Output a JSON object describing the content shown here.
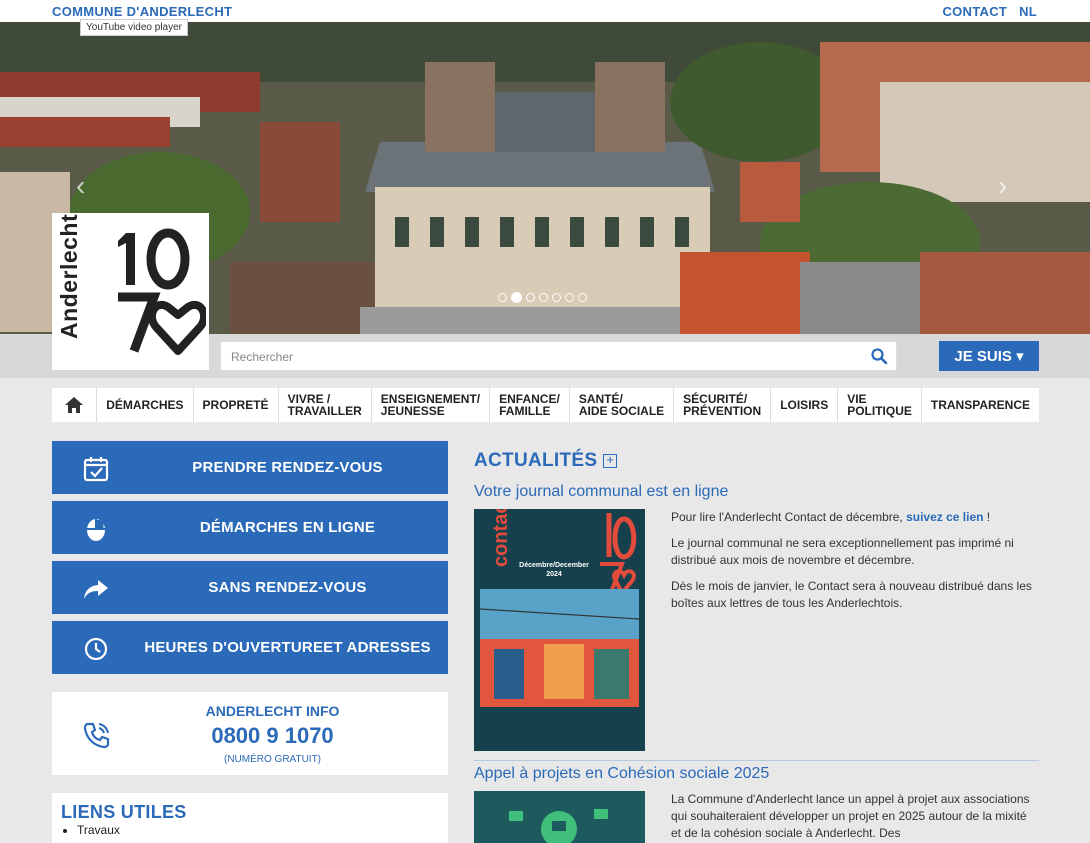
{
  "header": {
    "site_name": "COMMUNE D'ANDERLECHT",
    "contact": "CONTACT",
    "lang": "NL",
    "video_tooltip": "YouTube video player"
  },
  "hero": {
    "slides": 7,
    "active_slide": 2,
    "prev_icon": "chevron-left-icon",
    "next_icon": "chevron-right-icon"
  },
  "logo": {
    "word": "Anderlecht",
    "numerals": "1070"
  },
  "search": {
    "placeholder": "Rechercher",
    "icon": "search-icon"
  },
  "jesuis": {
    "label": "JE SUIS ▾"
  },
  "nav": {
    "home_icon": "home-icon",
    "items": [
      {
        "line1": "DÉMARCHES",
        "line2": ""
      },
      {
        "line1": "PROPRETÉ",
        "line2": ""
      },
      {
        "line1": "VIVRE /",
        "line2": "TRAVAILLER"
      },
      {
        "line1": "ENSEIGNEMENT/",
        "line2": "JEUNESSE"
      },
      {
        "line1": "ENFANCE/",
        "line2": "FAMILLE"
      },
      {
        "line1": "SANTÉ/",
        "line2": "AIDE SOCIALE"
      },
      {
        "line1": "SÉCURITÉ/",
        "line2": "PRÉVENTION"
      },
      {
        "line1": "LOISIRS",
        "line2": ""
      },
      {
        "line1": "VIE",
        "line2": "POLITIQUE"
      },
      {
        "line1": "TRANSPARENCE",
        "line2": ""
      }
    ]
  },
  "quick": [
    {
      "line1": "PRENDRE RENDEZ-VOUS",
      "line2": "",
      "icon": "calendar-check-icon"
    },
    {
      "line1": "DÉMARCHES EN LIGNE",
      "line2": "",
      "icon": "mouse-icon"
    },
    {
      "line1": "SANS RENDEZ-VOUS",
      "line2": "",
      "icon": "share-arrow-icon"
    },
    {
      "line1": "HEURES D'OUVERTURE",
      "line2": "ET ADRESSES",
      "icon": "clock-icon"
    }
  ],
  "info": {
    "title": "ANDERLECHT INFO",
    "phone": "0800 9 1070",
    "note": "(NUMÉRO GRATUIT)",
    "icon": "phone-ringing-icon"
  },
  "liens": {
    "title": "LIENS UTILES",
    "items": [
      "Travaux"
    ]
  },
  "actualites": {
    "title": "ACTUALITÉS",
    "articles": [
      {
        "title": "Votre journal communal est en ligne",
        "p1_before": "Pour lire l'Anderlecht Contact de décembre, ",
        "p1_link": "suivez ce lien",
        "p1_after": " !",
        "p2": "Le journal communal ne sera exceptionnellement pas imprimé ni distribué aux mois de novembre et décembre.",
        "p3": "Dès le mois de janvier, le Contact sera à nouveau distribué dans les boîtes aux lettres de tous les Anderlechtois.",
        "cover_title": "contact",
        "cover_date": "Décembre/December 2024"
      },
      {
        "title": "Appel à projets en Cohésion sociale 2025",
        "p1": "La Commune d'Anderlecht lance un appel à projet aux associations qui souhaiteraient développer un projet en 2025 autour de la mixité et de la cohésion sociale à Anderlecht. Des"
      }
    ]
  }
}
